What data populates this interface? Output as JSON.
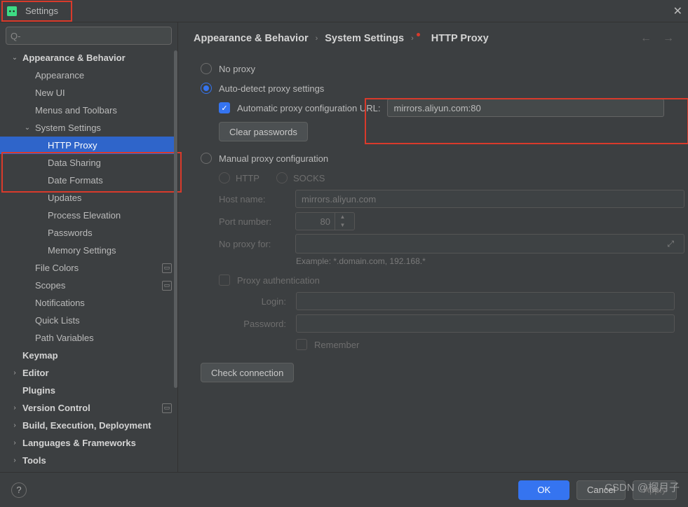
{
  "window": {
    "title": "Settings"
  },
  "search": {
    "placeholder": "Q-"
  },
  "sidebar": [
    {
      "label": "Appearance & Behavior",
      "depth": 0,
      "expand": "v",
      "bold": true
    },
    {
      "label": "Appearance",
      "depth": 1
    },
    {
      "label": "New UI",
      "depth": 1
    },
    {
      "label": "Menus and Toolbars",
      "depth": 1
    },
    {
      "label": "System Settings",
      "depth": 1,
      "expand": "v"
    },
    {
      "label": "HTTP Proxy",
      "depth": 2,
      "selected": true
    },
    {
      "label": "Data Sharing",
      "depth": 2
    },
    {
      "label": "Date Formats",
      "depth": 2
    },
    {
      "label": "Updates",
      "depth": 2
    },
    {
      "label": "Process Elevation",
      "depth": 2
    },
    {
      "label": "Passwords",
      "depth": 2
    },
    {
      "label": "Memory Settings",
      "depth": 2
    },
    {
      "label": "File Colors",
      "depth": 1,
      "badge": true
    },
    {
      "label": "Scopes",
      "depth": 1,
      "badge": true
    },
    {
      "label": "Notifications",
      "depth": 1
    },
    {
      "label": "Quick Lists",
      "depth": 1
    },
    {
      "label": "Path Variables",
      "depth": 1
    },
    {
      "label": "Keymap",
      "depth": 0,
      "bold": true
    },
    {
      "label": "Editor",
      "depth": 0,
      "expand": ">",
      "bold": true
    },
    {
      "label": "Plugins",
      "depth": 0,
      "bold": true
    },
    {
      "label": "Version Control",
      "depth": 0,
      "expand": ">",
      "bold": true,
      "badge": true
    },
    {
      "label": "Build, Execution, Deployment",
      "depth": 0,
      "expand": ">",
      "bold": true
    },
    {
      "label": "Languages & Frameworks",
      "depth": 0,
      "expand": ">",
      "bold": true
    },
    {
      "label": "Tools",
      "depth": 0,
      "expand": ">",
      "bold": true
    }
  ],
  "breadcrumb": [
    "Appearance & Behavior",
    "System Settings",
    "HTTP Proxy"
  ],
  "proxy": {
    "no_proxy": "No proxy",
    "auto_detect": "Auto-detect proxy settings",
    "auto_url_label": "Automatic proxy configuration URL:",
    "auto_url_value": "mirrors.aliyun.com:80",
    "clear_passwords": "Clear passwords",
    "manual": "Manual proxy configuration",
    "http": "HTTP",
    "socks": "SOCKS",
    "host_label": "Host name:",
    "host_value": "mirrors.aliyun.com",
    "port_label": "Port number:",
    "port_value": "80",
    "noproxy_label": "No proxy for:",
    "example": "Example: *.domain.com, 192.168.*",
    "auth": "Proxy authentication",
    "login": "Login:",
    "password": "Password:",
    "remember": "Remember",
    "check": "Check connection"
  },
  "footer": {
    "ok": "OK",
    "cancel": "Cancel",
    "apply": "Apply"
  },
  "watermark": "CSDN @榴月子"
}
